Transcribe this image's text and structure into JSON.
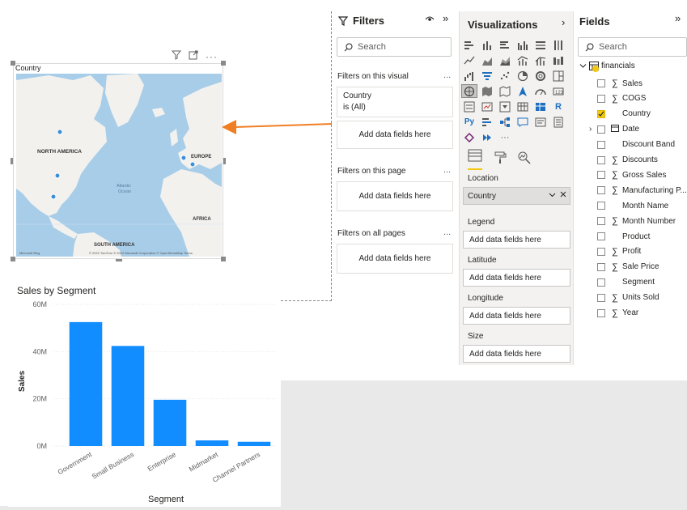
{
  "map": {
    "title": "Country",
    "labels": {
      "north_america": "NORTH AMERICA",
      "europe": "EUROPE",
      "africa": "AFRICA",
      "south_america": "SOUTH AMERICA",
      "atlantic": "Atlantic",
      "ocean": "Ocean",
      "attribution": "© 2022 TomTom  © 2022 Microsoft Corporation  © OpenStreetMap  Terms",
      "bing": "Microsoft Bing"
    },
    "colors": {
      "water": "#a8cde8",
      "land": "#f2f1ee",
      "dot": "#3a8fd6"
    }
  },
  "chart_data": {
    "type": "bar",
    "title": "Sales by Segment",
    "xlabel": "Segment",
    "ylabel": "Sales",
    "categories": [
      "Government",
      "Small Business",
      "Enterprise",
      "Midmarket",
      "Channel Partners"
    ],
    "values": [
      52.5,
      42.4,
      19.6,
      2.4,
      1.8
    ],
    "y_ticks": [
      "0M",
      "20M",
      "40M",
      "60M"
    ],
    "ylim": [
      0,
      60
    ],
    "grid": true,
    "color": "#118dff"
  },
  "filters": {
    "header": "Filters",
    "search_placeholder": "Search",
    "on_visual": "Filters on this visual",
    "card_field": "Country",
    "card_value": "is (All)",
    "add_fields": "Add data fields here",
    "on_page": "Filters on this page",
    "on_all": "Filters on all pages",
    "more": "..."
  },
  "viz": {
    "header": "Visualizations",
    "wells": {
      "location": "Location",
      "location_value": "Country",
      "legend": "Legend",
      "latitude": "Latitude",
      "longitude": "Longitude",
      "size": "Size",
      "add_fields": "Add data fields here"
    },
    "icon_text": {
      "py": "Py",
      "r": "R",
      "more": "···"
    }
  },
  "fields": {
    "header": "Fields",
    "search_placeholder": "Search",
    "table": "financials",
    "items": [
      {
        "label": "Sales",
        "sigma": true,
        "checked": false
      },
      {
        "label": "COGS",
        "sigma": true,
        "checked": false
      },
      {
        "label": "Country",
        "sigma": false,
        "checked": true
      },
      {
        "label": "Date",
        "sigma": false,
        "checked": false,
        "expandable": true
      },
      {
        "label": "Discount Band",
        "sigma": false,
        "checked": false
      },
      {
        "label": "Discounts",
        "sigma": true,
        "checked": false
      },
      {
        "label": "Gross Sales",
        "sigma": true,
        "checked": false
      },
      {
        "label": "Manufacturing P...",
        "sigma": true,
        "checked": false
      },
      {
        "label": "Month Name",
        "sigma": false,
        "checked": false
      },
      {
        "label": "Month Number",
        "sigma": true,
        "checked": false
      },
      {
        "label": "Product",
        "sigma": false,
        "checked": false
      },
      {
        "label": "Profit",
        "sigma": true,
        "checked": false
      },
      {
        "label": "Sale Price",
        "sigma": true,
        "checked": false
      },
      {
        "label": "Segment",
        "sigma": false,
        "checked": false
      },
      {
        "label": "Units Sold",
        "sigma": true,
        "checked": false
      },
      {
        "label": "Year",
        "sigma": true,
        "checked": false
      }
    ]
  },
  "accent": "#f2c811",
  "arrow_color": "#f07f23"
}
